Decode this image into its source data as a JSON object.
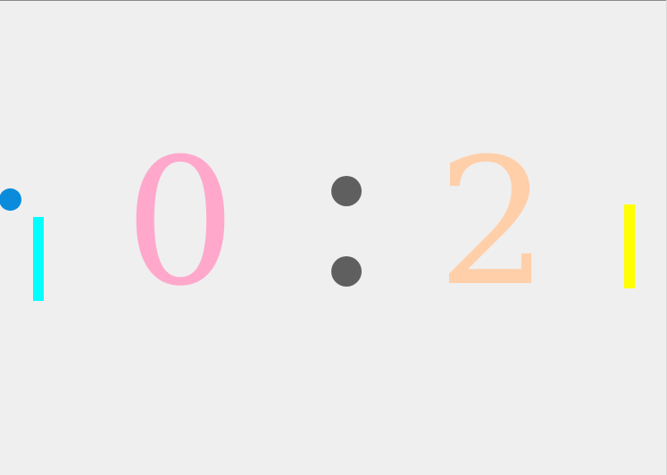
{
  "scoreboard": {
    "left_score": "0",
    "right_score": "2",
    "left_color": "#ffa8cc",
    "right_color": "#ffcfaa",
    "separator_color": "#5f5f5f"
  },
  "paddles": {
    "left_color": "#00ffff",
    "right_color": "#ffff00"
  },
  "ball": {
    "color": "#0a8bdc"
  },
  "background": "#efefef"
}
